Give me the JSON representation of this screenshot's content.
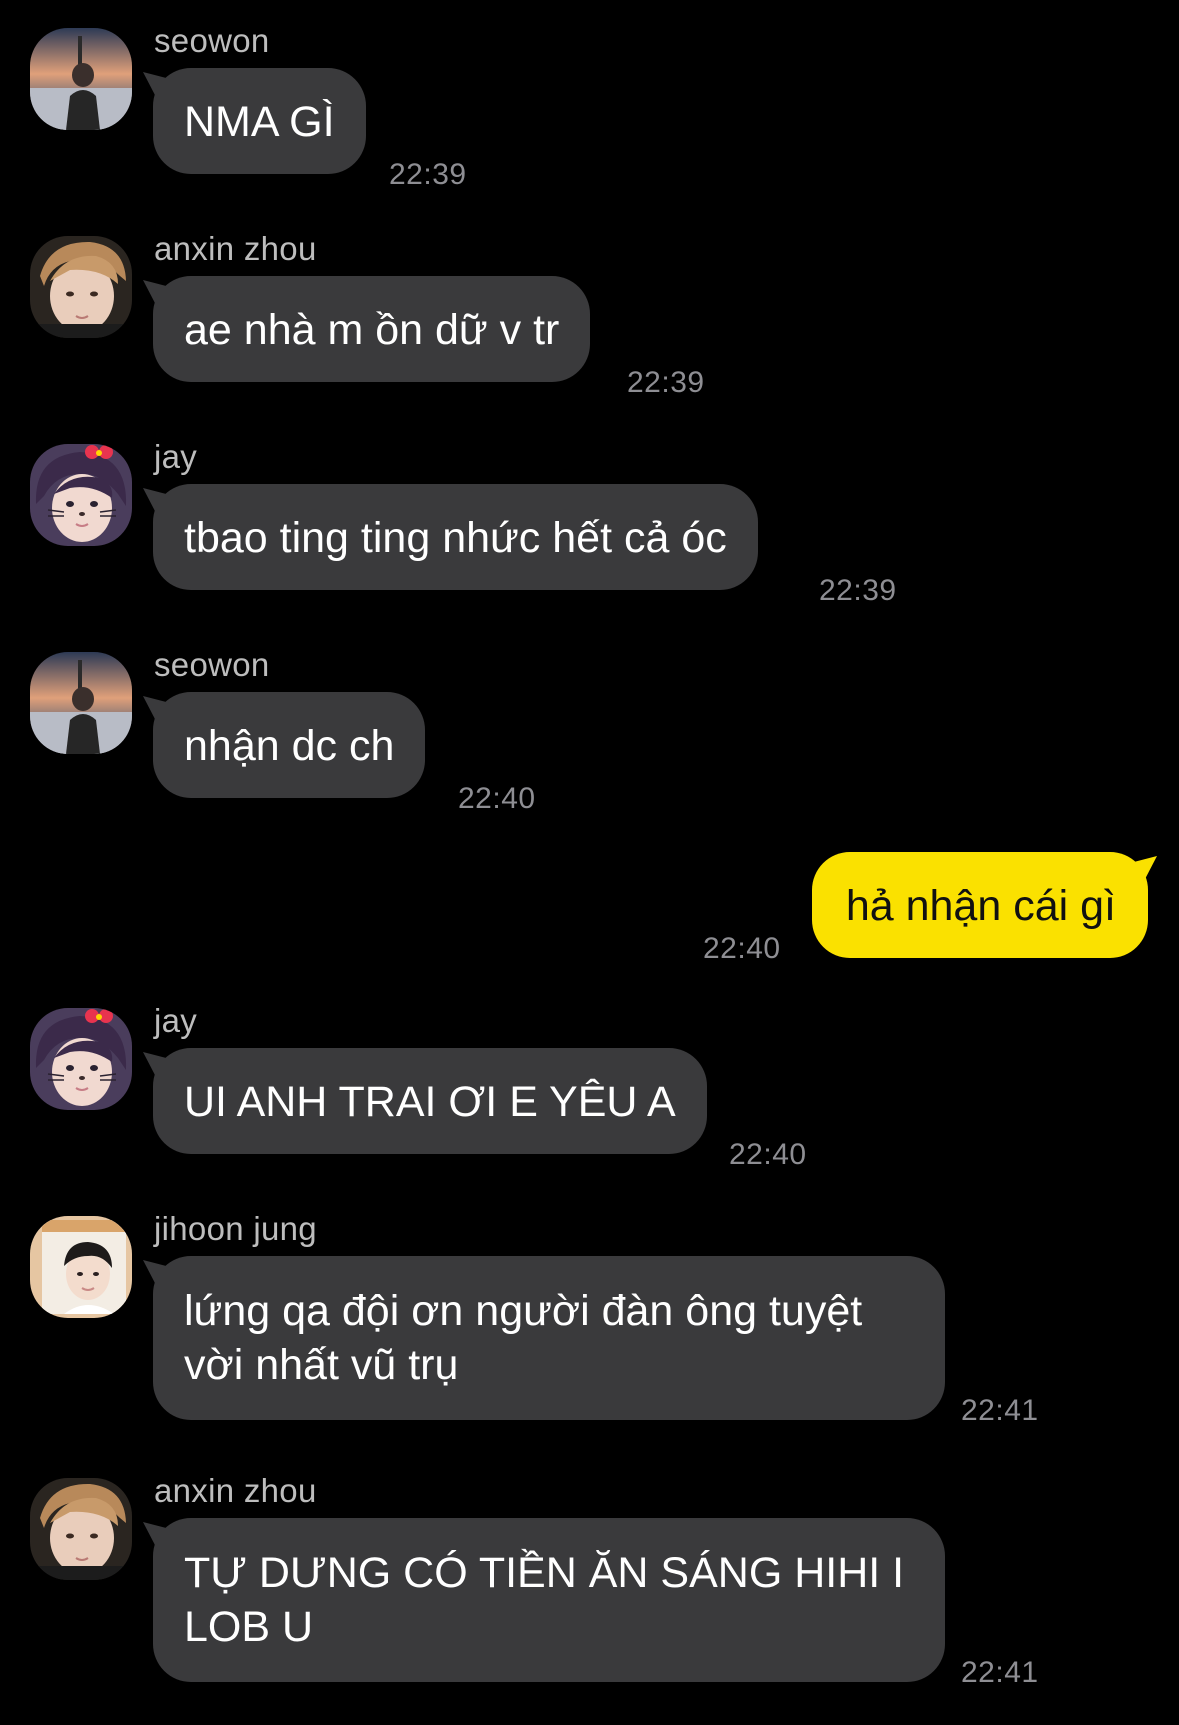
{
  "messages": [
    {
      "sender": "seowon",
      "text": "NMA GÌ",
      "time": "22:39",
      "avatar_icon": "seowon-avatar-icon"
    },
    {
      "sender": "anxin zhou",
      "text": "ae nhà m ồn dữ v tr",
      "time": "22:39",
      "avatar_icon": "anxin-zhou-avatar-icon"
    },
    {
      "sender": "jay",
      "text": "tbao ting ting nhức hết cả óc",
      "time": "22:39",
      "avatar_icon": "jay-avatar-icon"
    },
    {
      "sender": "seowon",
      "text": "nhận dc ch",
      "time": "22:40",
      "avatar_icon": "seowon-avatar-icon"
    },
    {
      "sender": "me",
      "text": "hả nhận cái gì",
      "time": "22:40"
    },
    {
      "sender": "jay",
      "text": "UI ANH TRAI ƠI E YÊU A",
      "time": "22:40",
      "avatar_icon": "jay-avatar-icon"
    },
    {
      "sender": "jihoon jung",
      "text": "lứng qa đội ơn người đàn ông tuyệt vời nhất vũ trụ",
      "time": "22:41",
      "avatar_icon": "jihoon-jung-avatar-icon"
    },
    {
      "sender": "anxin zhou",
      "text": "TỰ DƯNG CÓ TIỀN ĂN SÁNG HIHI I LOB U",
      "time": "22:41",
      "avatar_icon": "anxin-zhou-avatar-icon"
    }
  ],
  "colors": {
    "background": "#000000",
    "incoming_bubble": "#3a3a3c",
    "outgoing_bubble": "#fae100",
    "sender_name": "#bdbdbd",
    "timestamp": "#8e8e93"
  }
}
